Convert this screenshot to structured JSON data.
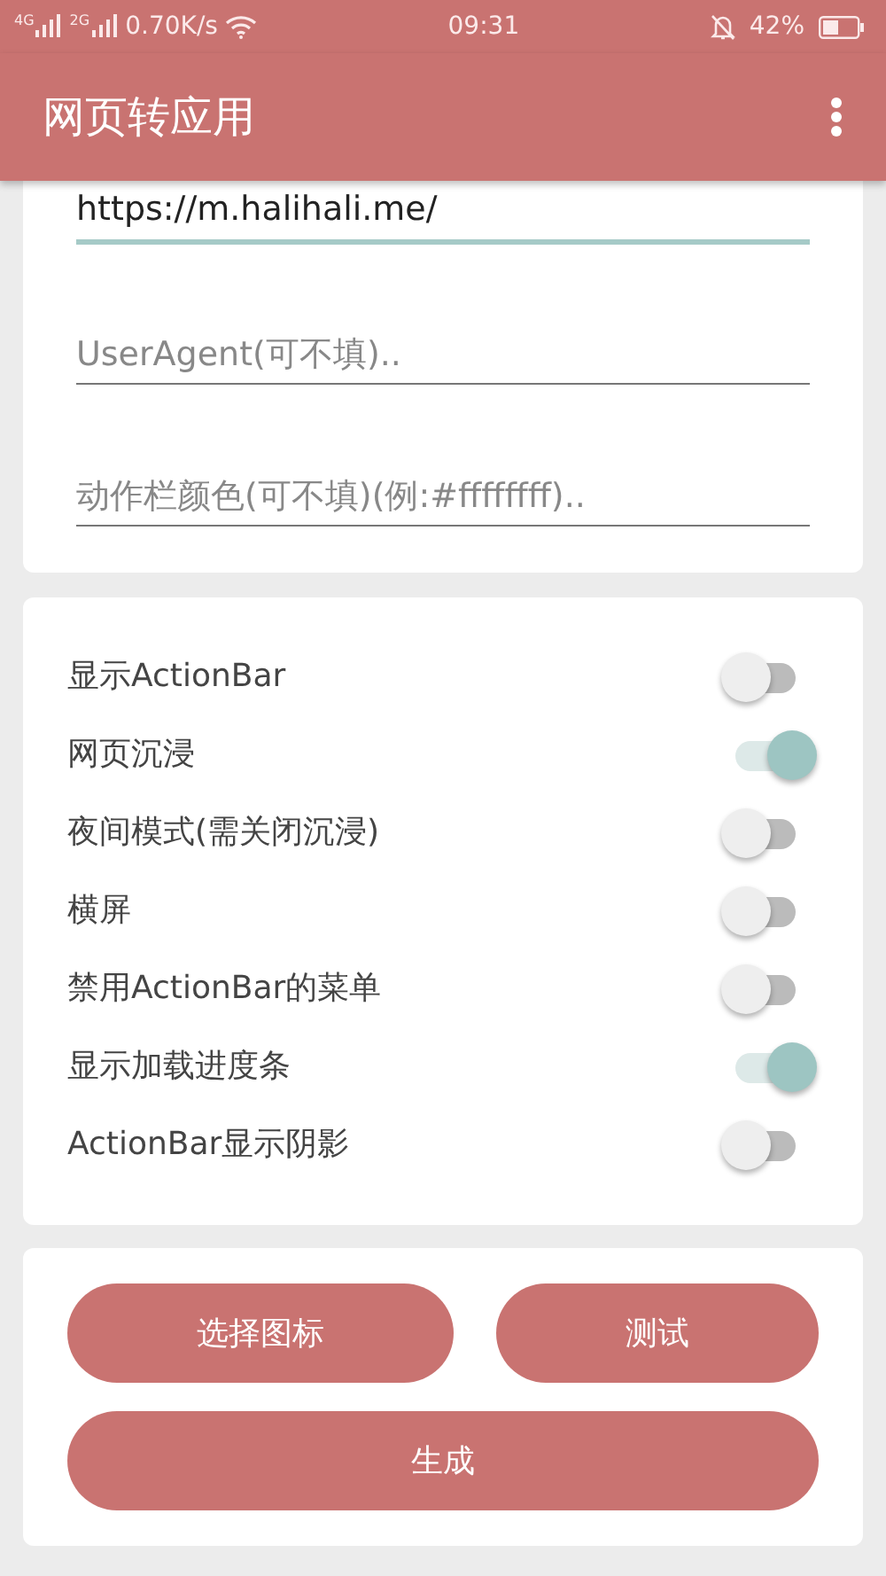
{
  "status_bar": {
    "sim1": "4G",
    "sim2": "2G",
    "speed": "0.70K/s",
    "time": "09:31",
    "battery": "42%"
  },
  "app_bar": {
    "title": "网页转应用"
  },
  "fields": [
    {
      "value": "https://m.halihali.me/",
      "focused": true
    },
    {
      "placeholder": "UserAgent(可不填)..",
      "focused": false
    },
    {
      "placeholder": "动作栏颜色(可不填)(例:#ffffffff)..",
      "focused": false
    }
  ],
  "switches": [
    {
      "label": "显示ActionBar",
      "on": false
    },
    {
      "label": "网页沉浸",
      "on": true
    },
    {
      "label": "夜间模式(需关闭沉浸)",
      "on": false
    },
    {
      "label": "横屏",
      "on": false
    },
    {
      "label": "禁用ActionBar的菜单",
      "on": false
    },
    {
      "label": "显示加载进度条",
      "on": true
    },
    {
      "label": "ActionBar显示阴影",
      "on": false
    }
  ],
  "buttons": [
    {
      "label": "选择图标",
      "kind": "half"
    },
    {
      "label": "测试",
      "kind": "half"
    },
    {
      "label": "生成",
      "kind": "full"
    }
  ]
}
